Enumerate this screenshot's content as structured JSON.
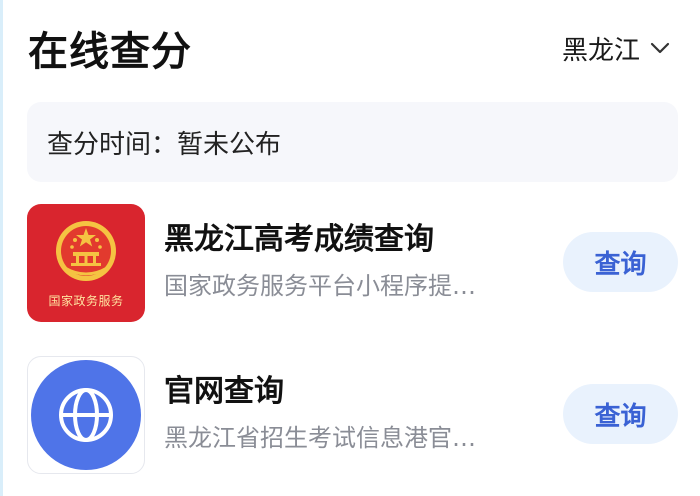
{
  "header": {
    "title": "在线查分",
    "region_label": "黑龙江",
    "region_icon": "chevron-down-icon"
  },
  "notice": {
    "text": "查分时间：暂未公布"
  },
  "items": [
    {
      "title": "黑龙江高考成绩查询",
      "subtitle": "国家政务服务平台小程序提…",
      "icon": "national-emblem-icon",
      "icon_text": "国家政务服务",
      "button_label": "查询"
    },
    {
      "title": "官网查询",
      "subtitle": "黑龙江省招生考试信息港官…",
      "icon": "globe-icon",
      "button_label": "查询"
    }
  ],
  "colors": {
    "accent": "#3a62d4",
    "button_bg": "#e9f2fd",
    "gov_red": "#d9252e",
    "globe_blue": "#4f74e8",
    "subtitle_gray": "#8a8d96",
    "notice_bg": "#f6f7fb"
  }
}
